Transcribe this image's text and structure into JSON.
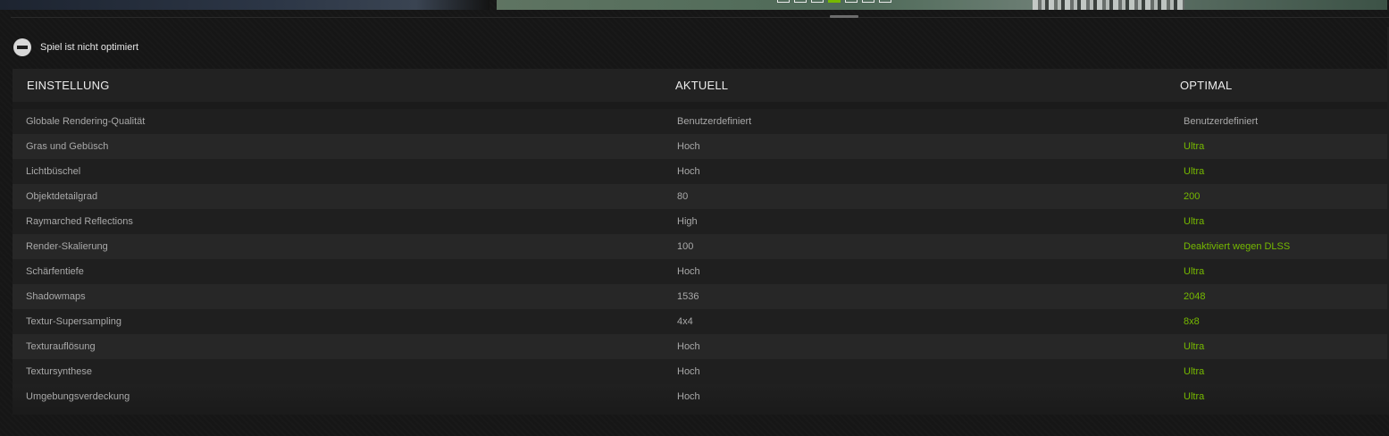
{
  "carousel": {
    "pages": 7,
    "active_index": 3
  },
  "status": {
    "icon": "minus-circle-icon",
    "text": "Spiel ist nicht optimiert"
  },
  "table": {
    "headers": {
      "setting": "EINSTELLUNG",
      "current": "AKTUELL",
      "optimal": "OPTIMAL"
    },
    "rows": [
      {
        "setting": "Globale Rendering-Qualität",
        "current": "Benutzerdefiniert",
        "optimal": "Benutzerdefiniert",
        "changed": false
      },
      {
        "setting": "Gras und Gebüsch",
        "current": "Hoch",
        "optimal": "Ultra",
        "changed": true
      },
      {
        "setting": "Lichtbüschel",
        "current": "Hoch",
        "optimal": "Ultra",
        "changed": true
      },
      {
        "setting": "Objektdetailgrad",
        "current": "80",
        "optimal": "200",
        "changed": true
      },
      {
        "setting": "Raymarched Reflections",
        "current": "High",
        "optimal": "Ultra",
        "changed": true
      },
      {
        "setting": "Render-Skalierung",
        "current": "100",
        "optimal": "Deaktiviert wegen DLSS",
        "changed": true
      },
      {
        "setting": "Schärfentiefe",
        "current": "Hoch",
        "optimal": "Ultra",
        "changed": true
      },
      {
        "setting": "Shadowmaps",
        "current": "1536",
        "optimal": "2048",
        "changed": true
      },
      {
        "setting": "Textur-Supersampling",
        "current": "4x4",
        "optimal": "8x8",
        "changed": true
      },
      {
        "setting": "Texturauflösung",
        "current": "Hoch",
        "optimal": "Ultra",
        "changed": true
      },
      {
        "setting": "Textursynthese",
        "current": "Hoch",
        "optimal": "Ultra",
        "changed": true
      },
      {
        "setting": "Umgebungsverdeckung",
        "current": "Hoch",
        "optimal": "Ultra",
        "changed": true
      }
    ]
  },
  "colors": {
    "accent_green": "#76b900",
    "background": "#161616",
    "header_bg": "#222222"
  }
}
